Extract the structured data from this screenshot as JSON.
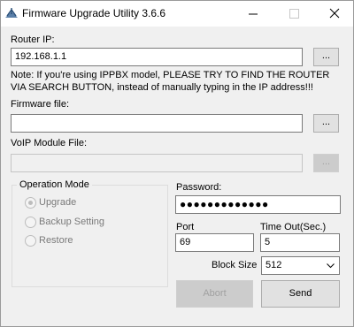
{
  "window": {
    "title": "Firmware Upgrade Utility 3.6.6"
  },
  "router": {
    "label": "Router IP:",
    "value": "192.168.1.1",
    "browse": "...",
    "note": "Note: If you're using IPPBX model, PLEASE TRY TO FIND THE ROUTER VIA SEARCH BUTTON, instead of manually typing in the IP address!!!"
  },
  "firmware": {
    "label": "Firmware file:",
    "value": "",
    "browse": "..."
  },
  "voip": {
    "label": "VoIP Module File:",
    "value": "",
    "browse": "..."
  },
  "operation": {
    "label": "Operation Mode",
    "options": [
      "Upgrade",
      "Backup Setting",
      "Restore"
    ],
    "selected": "Upgrade"
  },
  "password": {
    "label": "Password:",
    "masked": "●●●●●●●●●●●●●"
  },
  "port": {
    "label": "Port",
    "value": "69"
  },
  "timeout": {
    "label": "Time Out(Sec.)",
    "value": "5"
  },
  "block_size": {
    "label": "Block Size",
    "value": "512"
  },
  "buttons": {
    "abort": "Abort",
    "send": "Send"
  }
}
